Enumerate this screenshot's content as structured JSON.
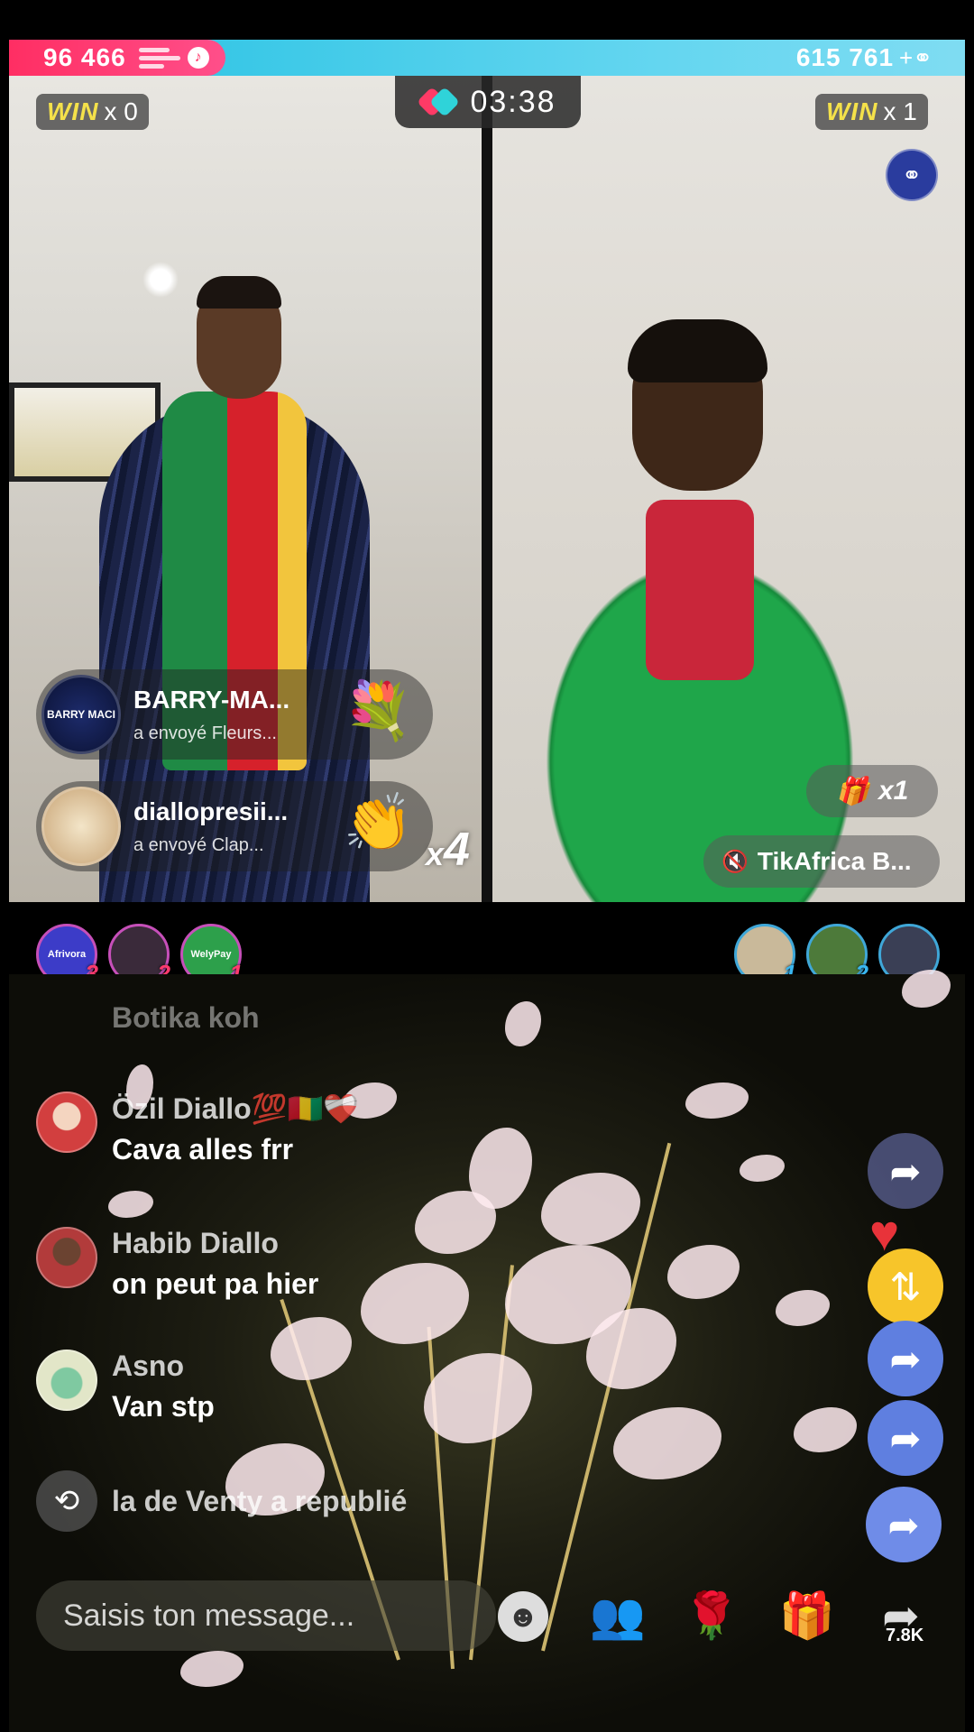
{
  "battle": {
    "left_score": "96 466",
    "right_score": "615 761",
    "timer": "03:38",
    "left_win_label": "WIN",
    "left_win_count": "x 0",
    "right_win_label": "WIN",
    "right_win_count": "x 1"
  },
  "gifts": [
    {
      "user": "BARRY-MA...",
      "action": "a envoyé  Fleurs...",
      "avatar_text": "BARRY MACI",
      "icon": "bouquet-icon"
    },
    {
      "user": "diallopresii...",
      "action": "a envoyé  Clap...",
      "icon": "clap-icon"
    }
  ],
  "combo": {
    "prefix": "x",
    "count": "4"
  },
  "right_gift_pill": {
    "count": "x1"
  },
  "right_creator": {
    "name": "TikAfrica B..."
  },
  "top_supporters_left": [
    {
      "label": "Afrivora",
      "rank": "3"
    },
    {
      "label": "",
      "rank": "2"
    },
    {
      "label": "WelyPay",
      "rank": "1"
    }
  ],
  "top_supporters_right": [
    {
      "label": "",
      "rank": "1"
    },
    {
      "label": "",
      "rank": "2"
    },
    {
      "label": "",
      "rank": ""
    }
  ],
  "chat": [
    {
      "name": "Botika koh",
      "text": ""
    },
    {
      "name": "Özil Diallo💯🇬🇳❤️‍🩹",
      "text": "Cava alles frr"
    },
    {
      "name": "Habib Diallo",
      "text": "on peut pa hier"
    },
    {
      "name": "Asno",
      "text": "Van stp"
    },
    {
      "name": "",
      "text": "la de Venty a republié"
    }
  ],
  "input": {
    "placeholder": "Saisis ton message..."
  },
  "share": {
    "count": "7.8K"
  },
  "colors": {
    "pink": "#ff2e63",
    "cyan": "#37c7e6",
    "win_yellow": "#f4e14a",
    "repost_yellow": "#f7c52a",
    "share_blue": "#5f7fe0"
  }
}
